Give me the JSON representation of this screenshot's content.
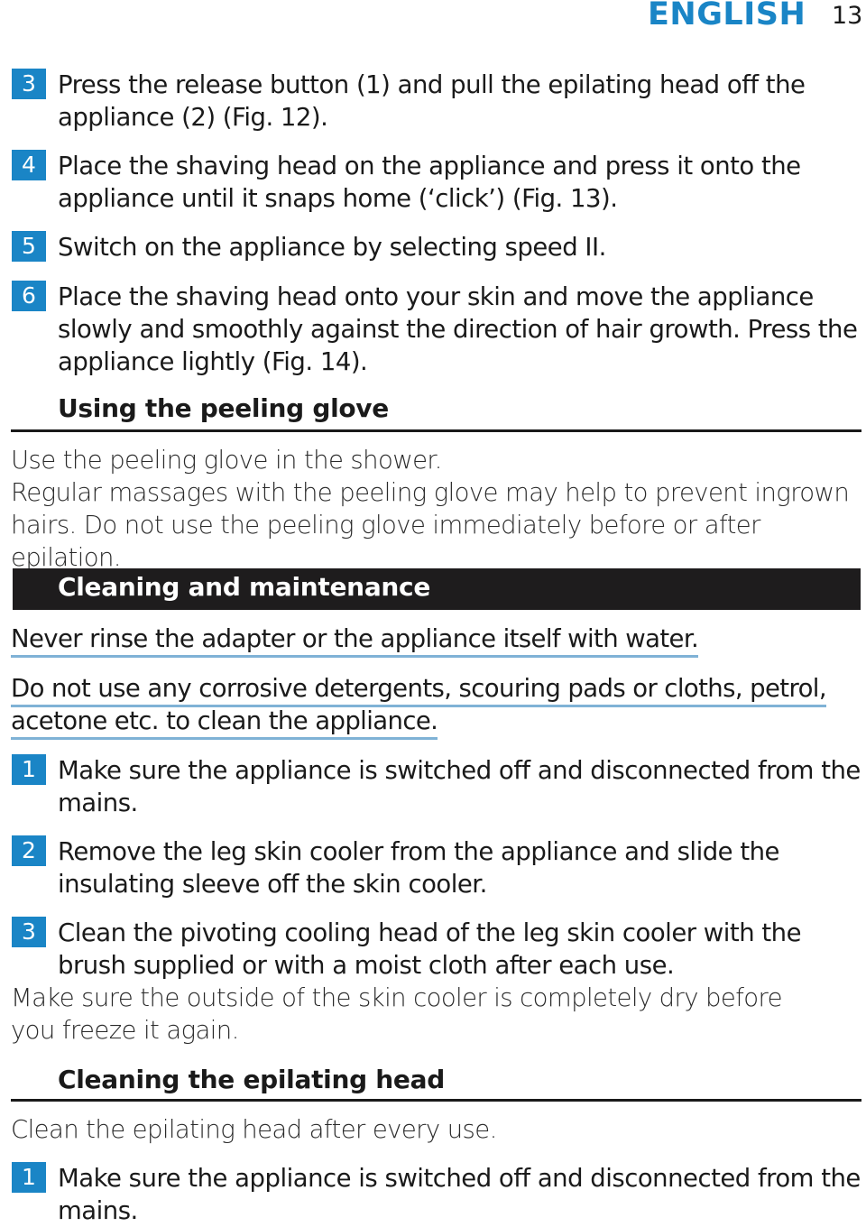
{
  "header": {
    "language": "ENGLISH",
    "page_number": "13"
  },
  "top_steps": [
    {
      "number": "3",
      "text": "Press the release button (1) and pull the epilating head off the appliance (2) (Fig. 12)."
    },
    {
      "number": "4",
      "text": "Place the shaving head on the appliance and press it onto the appliance until it snaps home (‘click’) (Fig. 13)."
    },
    {
      "number": "5",
      "text": "Switch on the appliance by selecting speed II."
    },
    {
      "number": "6",
      "text": "Place the shaving head onto your skin and move the appliance slowly and smoothly against the direction of hair growth. Press the appliance lightly (Fig. 14)."
    }
  ],
  "peeling": {
    "title": "Using the peeling glove",
    "para1": "Use the peeling glove in the shower.",
    "para2": "Regular massages with the peeling glove may help to prevent ingrown hairs. Do not use the peeling glove immediately before or after epilation."
  },
  "cleaning": {
    "title": "Cleaning and maintenance",
    "warning1": "Never rinse the adapter or the appliance itself with water.",
    "warning2_line1": "Do not use any corrosive detergents, scouring pads or cloths, petrol,",
    "warning2_line2": "acetone etc. to clean the appliance.",
    "steps": [
      {
        "number": "1",
        "text": "Make sure the appliance is switched off and disconnected from the mains."
      },
      {
        "number": "2",
        "text": "Remove the leg skin cooler from the appliance and slide the insulating sleeve off the skin cooler."
      },
      {
        "number": "3",
        "text": "Clean the pivoting cooling head of the leg skin cooler with the brush supplied or with a moist cloth after each use."
      }
    ],
    "note": "Make sure the outside of the skin cooler is completely dry before you freeze it again."
  },
  "epilating_head": {
    "title": "Cleaning the epilating head",
    "para": "Clean the epilating head after every use.",
    "steps": [
      {
        "number": "1",
        "text": "Make sure the appliance is switched off and disconnected from the mains."
      }
    ]
  }
}
